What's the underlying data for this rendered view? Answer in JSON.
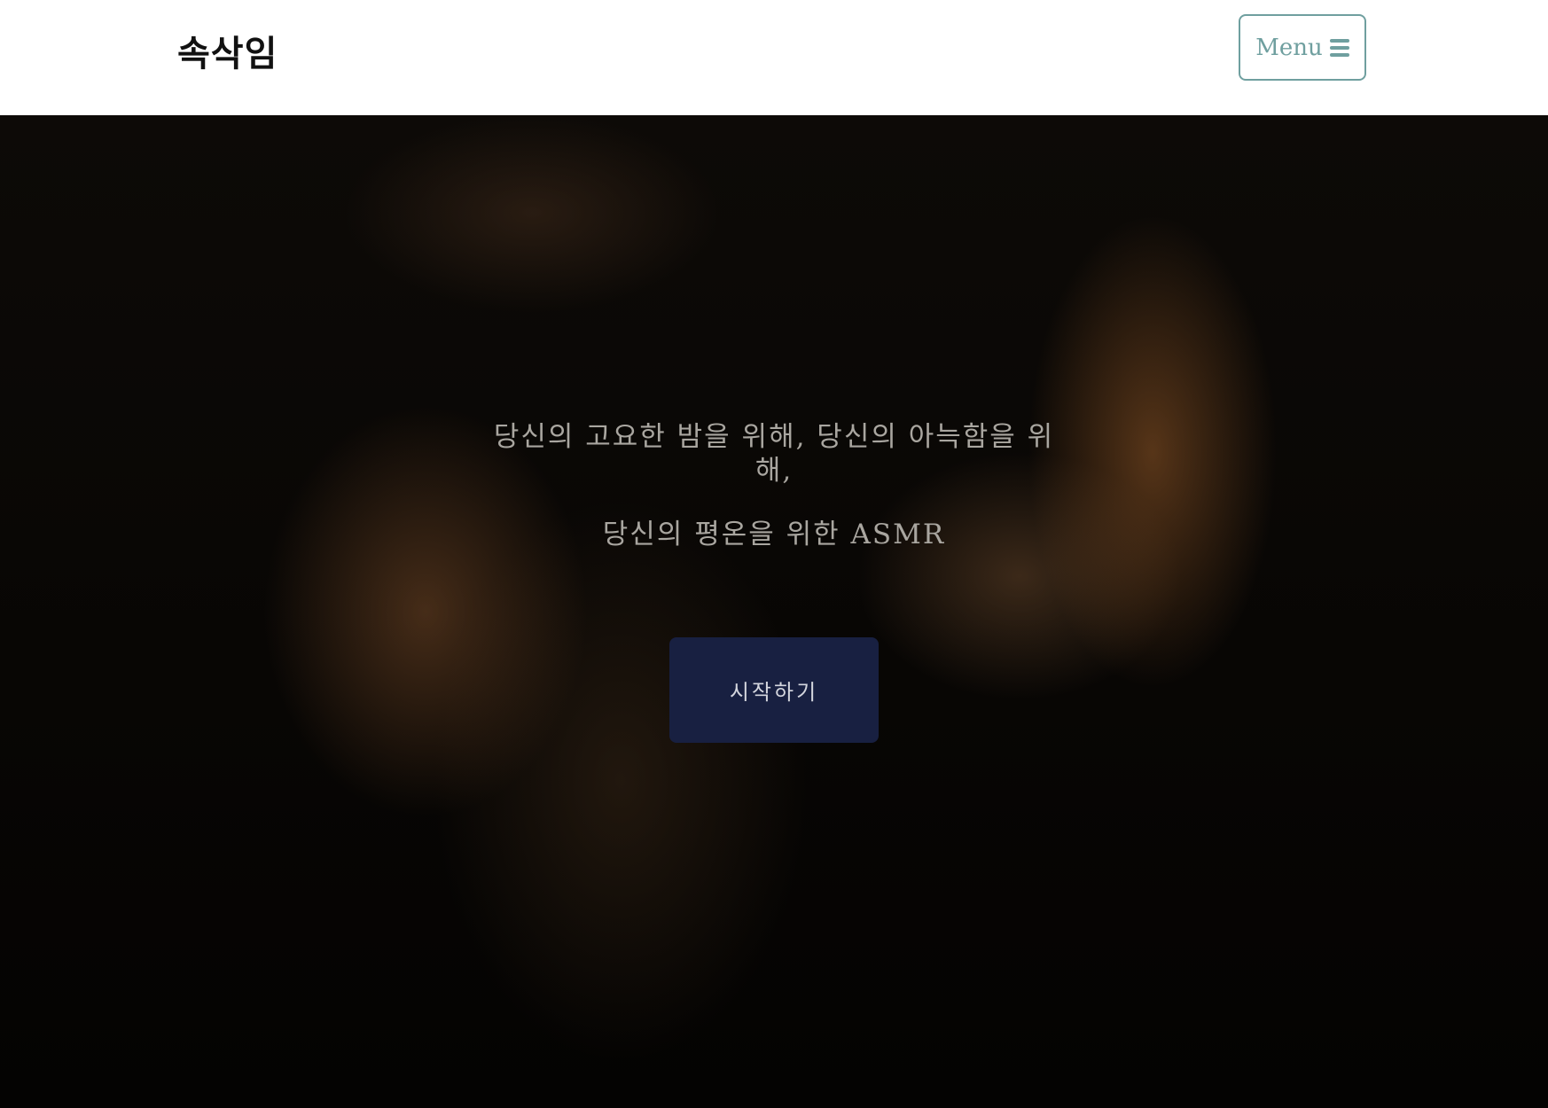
{
  "header": {
    "logo": "속삭임",
    "menu_label": "Menu",
    "menu_icon": "hamburger-icon",
    "accent_color": "#6f9f9f"
  },
  "hero": {
    "tagline_line1": "당신의 고요한 밤을 위해, 당신의 아늑함을 위해,",
    "tagline_line2": "당신의 평온을 위한 ASMR",
    "start_button": "시작하기",
    "button_color": "#182041"
  }
}
